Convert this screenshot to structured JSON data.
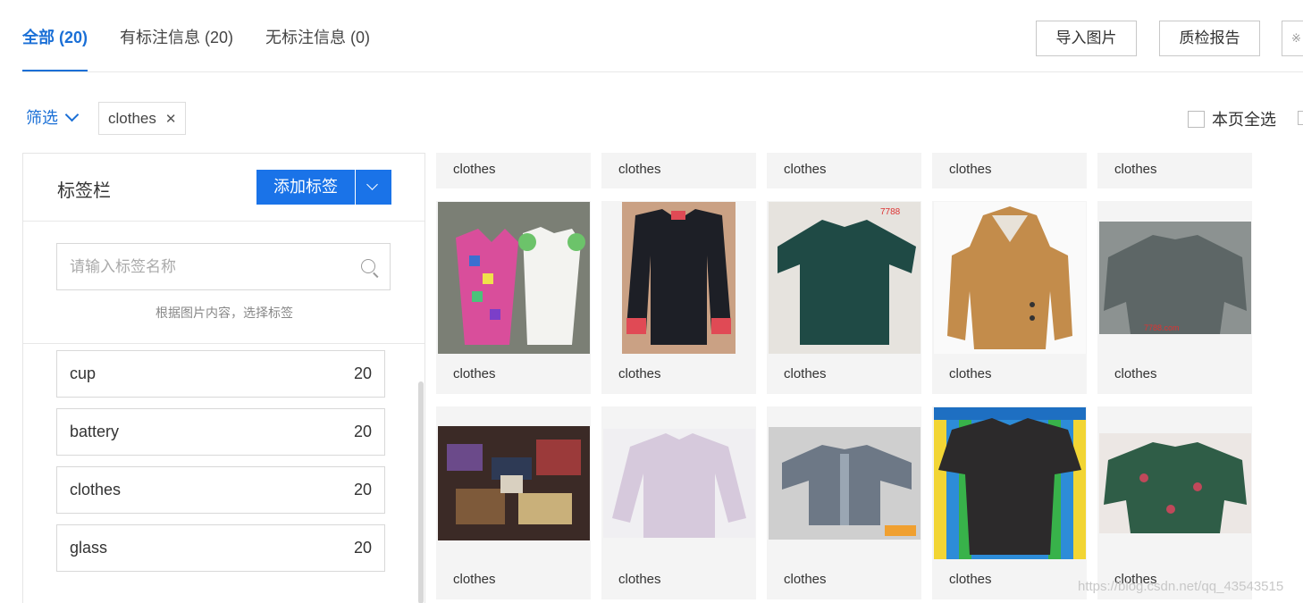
{
  "tabs": [
    {
      "label": "全部 (20)",
      "active": true
    },
    {
      "label": "有标注信息 (20)",
      "active": false
    },
    {
      "label": "无标注信息 (0)",
      "active": false
    }
  ],
  "toolbar": {
    "import_label": "导入图片",
    "report_label": "质检报告",
    "more_label": "※"
  },
  "filter": {
    "label": "筛选",
    "chip_label": "clothes",
    "chip_close": "✕",
    "select_all_label": "本页全选"
  },
  "label_panel": {
    "title": "标签栏",
    "add_button": "添加标签",
    "search_placeholder": "请输入标签名称",
    "hint": "根据图片内容，选择标签",
    "labels": [
      {
        "name": "cup",
        "count": "20"
      },
      {
        "name": "battery",
        "count": "20"
      },
      {
        "name": "clothes",
        "count": "20"
      },
      {
        "name": "glass",
        "count": "20"
      }
    ]
  },
  "gallery": {
    "caption": "clothes",
    "row_top": [
      "clothes",
      "clothes",
      "clothes",
      "clothes",
      "clothes"
    ],
    "row_mid": [
      "clothes",
      "clothes",
      "clothes",
      "clothes",
      "clothes"
    ],
    "row_bottom": [
      "clothes",
      "clothes",
      "clothes",
      "clothes",
      "clothes"
    ]
  },
  "watermark": "https://blog.csdn.net/qq_43543515",
  "colors": {
    "accent": "#1a6fd6",
    "button": "#1a73e8"
  }
}
